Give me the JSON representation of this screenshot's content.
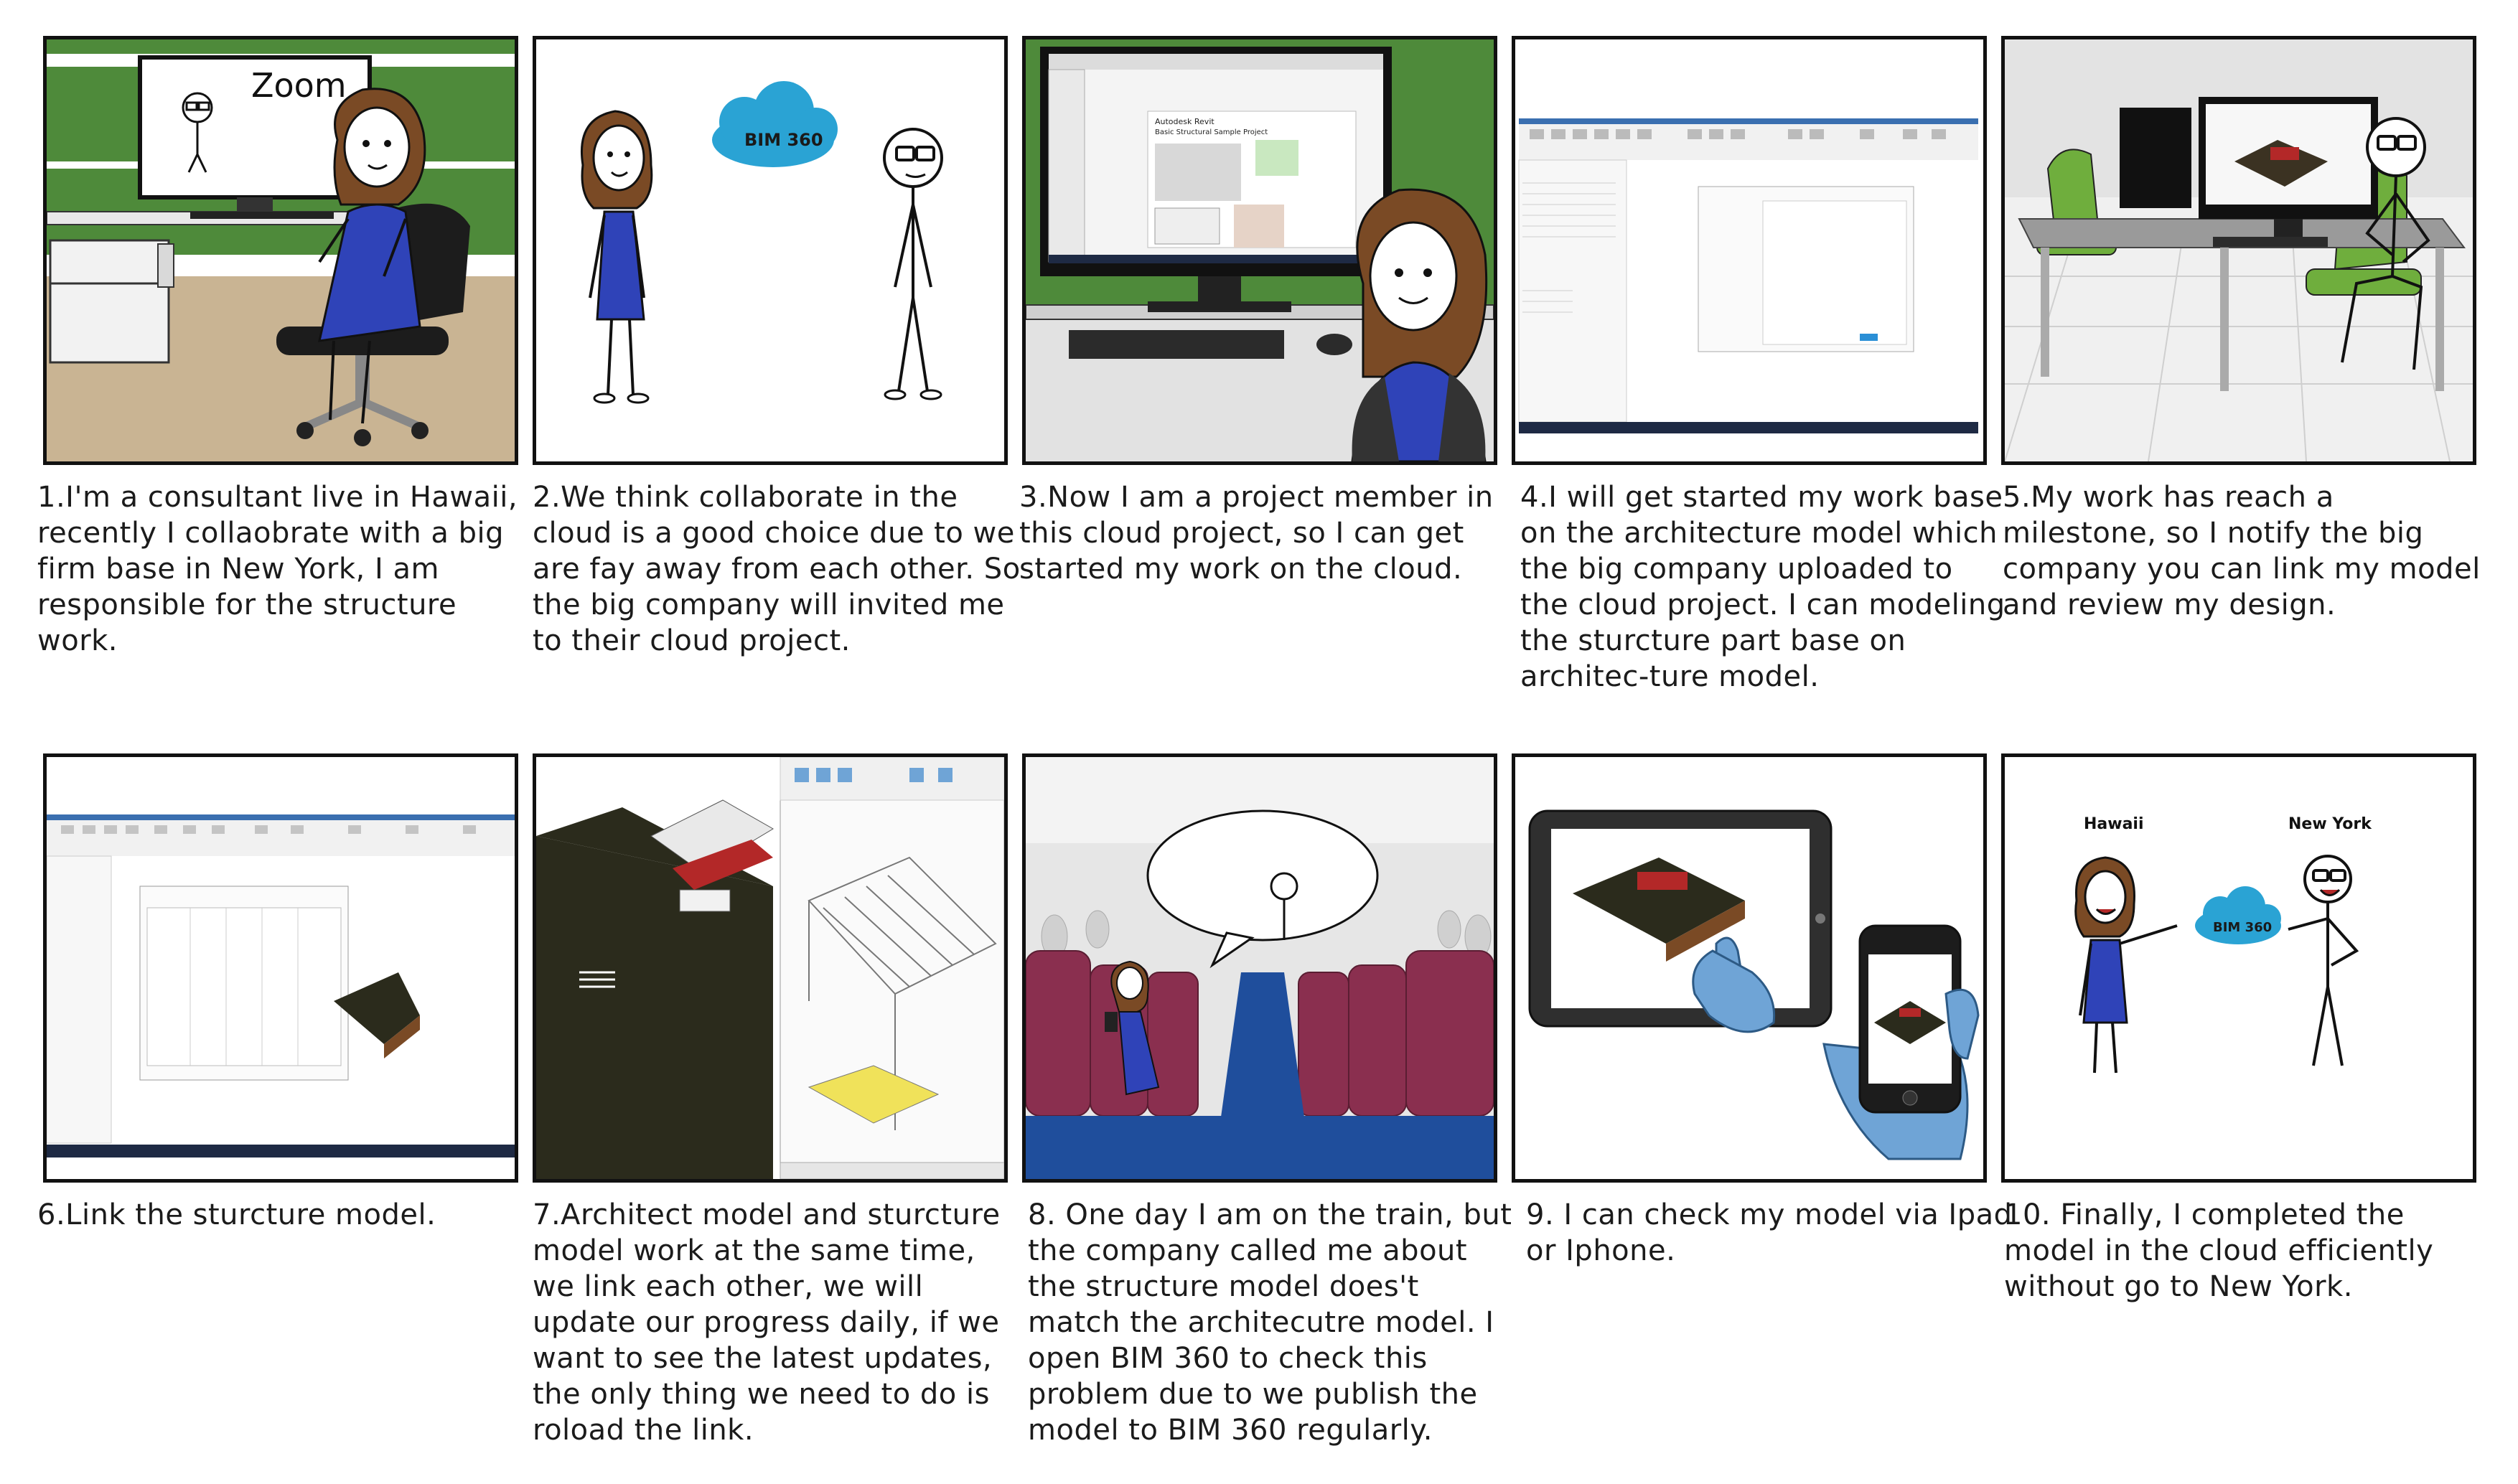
{
  "panels": [
    {
      "caption": "1.I'm a consultant live in Hawaii, recently I collaobrate with a big firm base in New York, I am responsible for the structure work.",
      "screen_label": "Zoom"
    },
    {
      "caption": "2.We think collaborate in the cloud is a good choice due to we are fay away from each other. So the big company will invited me to their cloud project.",
      "cloud_label": "BIM 360"
    },
    {
      "caption": "3.Now I am a project member in this cloud project, so I can get started my work on the cloud.",
      "screen_title": "Autodesk Revit",
      "screen_subtitle": "Basic Structural Sample Project"
    },
    {
      "caption": "4.I will get started my work base on the architecture model which the big company uploaded to the cloud project. I can modeling the sturcture part base on architec-ture model."
    },
    {
      "caption": "5.My work has reach a milestone, so I notify the big company you can link my model and review my design."
    },
    {
      "caption": "6.Link the sturcture model."
    },
    {
      "caption": "7.Architect model and sturcture model work at the same time, we link each other, we will update our progress daily, if we want to see the latest updates, the only thing we need to do is roload the link."
    },
    {
      "caption": "8. One day I am on the train, but the company called me about the structure model does't match the architecutre model. I open BIM 360 to check this problem due to we publish the model to BIM 360 regularly."
    },
    {
      "caption": "9. I can check my model via Ipad or Iphone."
    },
    {
      "caption": "10. Finally, I completed the model in the cloud efficiently without go to New York.",
      "left_label": "Hawaii",
      "right_label": "New York",
      "cloud_label": "BIM 360"
    }
  ],
  "colors": {
    "wall_green": "#4e8a3a",
    "floor": "#c9b493",
    "dress": "#2f43b8",
    "hair": "#7a4a25",
    "cloud": "#2aa3d4",
    "seat": "#8a2f4f",
    "aisle": "#1f4e9c",
    "chair_green": "#6fae3d",
    "hand": "#6fa4d6"
  }
}
